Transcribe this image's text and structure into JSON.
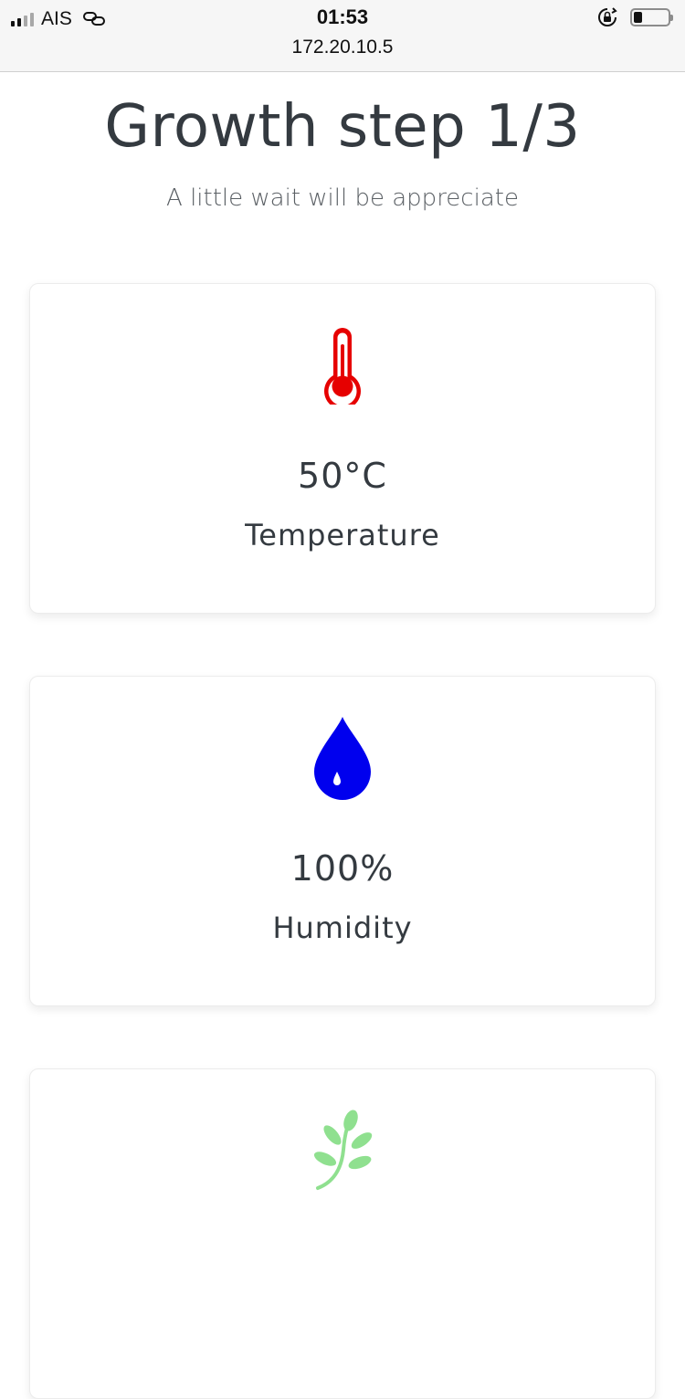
{
  "status_bar": {
    "carrier": "AIS",
    "time": "01:53",
    "url": "172.20.10.5",
    "battery_level": 0.25
  },
  "header": {
    "title": "Growth step 1/3",
    "subtitle": "A little wait will be appreciate"
  },
  "cards": [
    {
      "icon": "thermometer-icon",
      "color": "#e60000",
      "value": "50°C",
      "label": "Temperature"
    },
    {
      "icon": "water-drop-icon",
      "color": "#0000ee",
      "value": "100%",
      "label": "Humidity"
    },
    {
      "icon": "plant-sprout-icon",
      "color": "#8fe08f"
    }
  ]
}
